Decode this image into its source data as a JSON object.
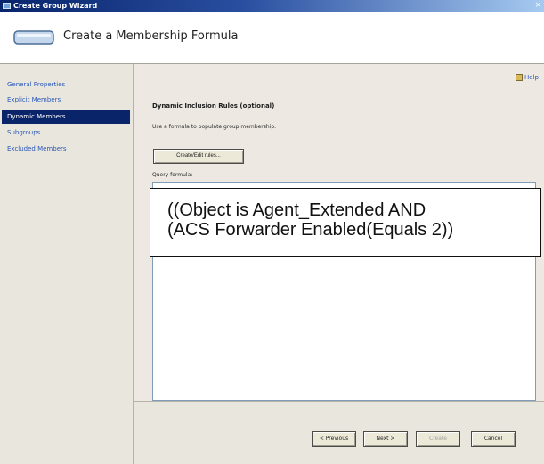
{
  "window": {
    "title": "Create Group Wizard",
    "close_glyph": "×"
  },
  "header": {
    "heading": "Create a Membership Formula",
    "icon": "group-wizard-icon"
  },
  "nav": {
    "items": [
      {
        "label": "General Properties",
        "selected": false
      },
      {
        "label": "Explicit Members",
        "selected": false
      },
      {
        "label": "Dynamic Members",
        "selected": true
      },
      {
        "label": "Subgroups",
        "selected": false
      },
      {
        "label": "Excluded Members",
        "selected": false
      }
    ]
  },
  "content": {
    "help_label": "Help",
    "section_title": "Dynamic Inclusion Rules (optional)",
    "section_description": "Use a formula to populate group membership.",
    "create_edit_label": "Create/Edit rules...",
    "query_label": "Query formula:",
    "query_value": "",
    "formula_lines": [
      "((Object is Agent_Extended AND",
      "(ACS Forwarder Enabled(Equals 2))"
    ]
  },
  "footer": {
    "previous_label": "< Previous",
    "next_label": "Next >",
    "create_label": "Create",
    "cancel_label": "Cancel"
  },
  "colors": {
    "selected_nav_bg": "#0a246a",
    "link_text": "#2a58b8",
    "titlebar": "#08246b"
  }
}
